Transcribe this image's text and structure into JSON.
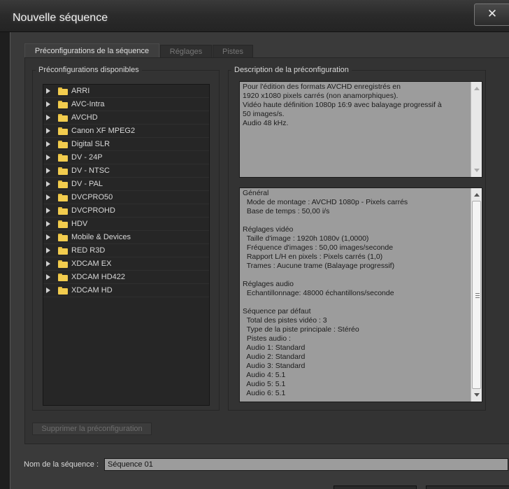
{
  "window": {
    "title": "Nouvelle séquence",
    "close_glyph": "✕"
  },
  "tabs": [
    {
      "label": "Préconfigurations de la séquence",
      "active": true
    },
    {
      "label": "Réglages",
      "active": false
    },
    {
      "label": "Pistes",
      "active": false
    }
  ],
  "presets": {
    "group_title": "Préconfigurations disponibles",
    "items": [
      "ARRI",
      "AVC-Intra",
      "AVCHD",
      "Canon XF MPEG2",
      "Digital SLR",
      "DV - 24P",
      "DV - NTSC",
      "DV - PAL",
      "DVCPRO50",
      "DVCPROHD",
      "HDV",
      "Mobile & Devices",
      "RED R3D",
      "XDCAM EX",
      "XDCAM HD422",
      "XDCAM HD"
    ],
    "delete_button": "Supprimer la préconfiguration"
  },
  "description": {
    "group_title": "Description de la préconfiguration",
    "summary_lines": [
      "Pour l'édition des formats AVCHD enregistrés en",
      "1920 x1080 pixels carrés (non anamorphiques).",
      "Vidéo haute définition 1080p 16:9 avec balayage progressif à",
      "50 images/s.",
      "Audio 48 kHz."
    ],
    "details_lines": [
      "Général",
      "  Mode de montage : AVCHD 1080p - Pixels carrés",
      "  Base de temps : 50,00 i/s",
      "",
      "Réglages vidéo",
      "  Taille d'image : 1920h 1080v (1,0000)",
      "  Fréquence d'images : 50,00 images/seconde",
      "  Rapport L/H en pixels : Pixels carrés (1,0)",
      "  Trames : Aucune trame (Balayage progressif)",
      "",
      "Réglages audio",
      "  Echantillonnage: 48000 échantillons/seconde",
      "",
      "Séquence par défaut",
      "  Total des pistes vidéo : 3",
      "  Type de la piste principale : Stéréo",
      "  Pistes audio :",
      "  Audio 1: Standard",
      "  Audio 2: Standard",
      "  Audio 3: Standard",
      "  Audio 4: 5.1",
      "  Audio 5: 5.1",
      "  Audio 6: 5.1"
    ]
  },
  "sequence_name": {
    "label": "Nom de la séquence :",
    "value": "Séquence 01"
  },
  "colors": {
    "dialog_bg": "#3a3a3a",
    "panel_bg": "#333333",
    "tree_bg": "#262626",
    "textbox_bg": "#9c9c9c",
    "folder": "#f2cc4e"
  }
}
